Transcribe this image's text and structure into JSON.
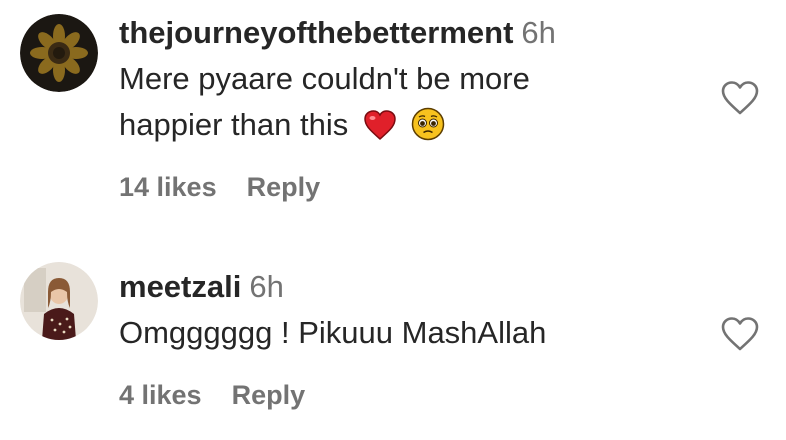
{
  "comments": [
    {
      "username": "thejourneyofthebetterment",
      "time": "6h",
      "text_line1": "Mere pyaare couldn't be more",
      "text_line2": "happier than this",
      "emojis": [
        "red-heart-icon",
        "pleading-face-icon"
      ],
      "likes": "14 likes",
      "reply": "Reply"
    },
    {
      "username": "meetzali",
      "time": "6h",
      "text": "Omgggggg ! Pikuuu MashAllah",
      "likes": "4 likes",
      "reply": "Reply"
    }
  ],
  "colors": {
    "text": "#262626",
    "secondary": "#737373",
    "heart_emoji": "#e0202a",
    "face_emoji": "#f7c21e"
  }
}
